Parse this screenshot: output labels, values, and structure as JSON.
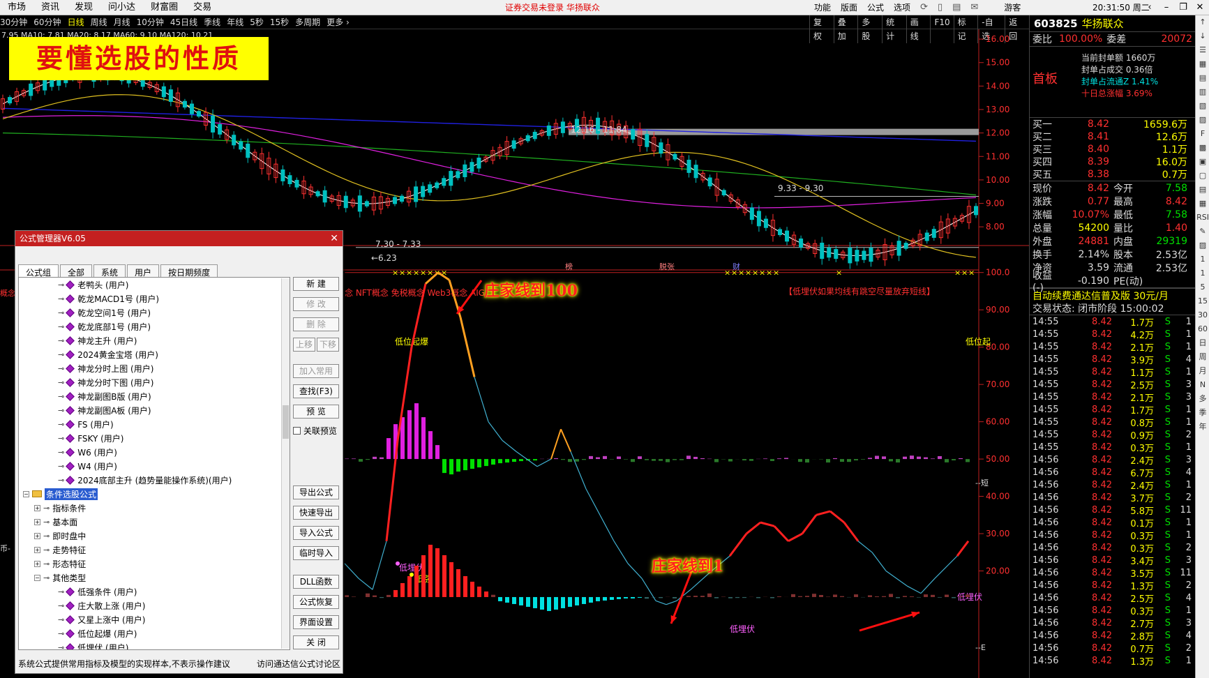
{
  "menubar": {
    "items": [
      "市场",
      "资讯",
      "发现",
      "问小达",
      "财富圈",
      "交易"
    ],
    "warning": "证券交易未登录  华扬联众",
    "right_items": [
      "功能",
      "版面",
      "公式",
      "选项"
    ],
    "user": "游客",
    "clock": "20:31:50 周二"
  },
  "periods": {
    "items": [
      "30分钟",
      "60分钟",
      "日线",
      "周线",
      "月线",
      "10分钟",
      "45日线",
      "季线",
      "年线",
      "5秒",
      "15秒",
      "多周期",
      "更多 ›"
    ],
    "active": "日线",
    "tools": [
      "复权",
      "叠加",
      "多股",
      "统计",
      "画线",
      "F10",
      "标记",
      "-自选",
      "返回"
    ]
  },
  "ma_legend": "7.95  MA10: 7.81  MA20: 8.17  MA60: 9.10  MA120: 10.21",
  "banner": "要懂选股的性质",
  "price_axis": [
    "16.00",
    "15.00",
    "14.00",
    "13.00",
    "12.00",
    "11.00",
    "10.00",
    "9.00",
    "8.00"
  ],
  "osc_axis": [
    "100.0",
    "90.00",
    "80.00",
    "70.00",
    "60.00",
    "50.00",
    "40.00",
    "30.00",
    "20.00"
  ],
  "chart_labels": {
    "range1": "12.16 - 11.84",
    "range2": "9.33 - 9.30",
    "range3": "7.30 - 7.33",
    "low": "←6.23",
    "tag_bang": "榜",
    "tag_chuzhang": "脱张",
    "tag_cai": "财",
    "concept": "念 NFT概念 免税概念 Web3概念 AIG",
    "concept_left": "概念",
    "tip": "【低埋伏如果均线有跳空尽量放弃短线】",
    "low_start_1": "低位起爆",
    "low_start_2": "低位起",
    "low_ambush_1": "低埋伏",
    "low_strong": "低强",
    "low_ambush_2": "低埋伏",
    "low_ambush_3": "低埋伏",
    "right_marker": "--短",
    "right_marker2": "--E",
    "left_coin": "币-"
  },
  "annotations": {
    "to100": "庄家线到100",
    "to1": "庄家线到1"
  },
  "stock": {
    "code": "603825",
    "name": "华扬联众",
    "webi_label": "委比",
    "webi": "100.00%",
    "weicha_label": "委差",
    "weicha": "20072",
    "first_board": "首板",
    "info": [
      "当前封单额 1660万",
      "封单占成交 0.36倍",
      "封单占流通Z 1.41%",
      "十日总涨幅 3.69%"
    ],
    "orderbook": [
      {
        "label": "买一",
        "price": "8.42",
        "vol": "1659.6万"
      },
      {
        "label": "买二",
        "price": "8.41",
        "vol": "12.6万"
      },
      {
        "label": "买三",
        "price": "8.40",
        "vol": "1.1万"
      },
      {
        "label": "买四",
        "price": "8.39",
        "vol": "16.0万"
      },
      {
        "label": "买五",
        "price": "8.38",
        "vol": "0.7万"
      }
    ],
    "quotes": [
      {
        "k1": "现价",
        "v1": "8.42",
        "c1": "red",
        "k2": "今开",
        "v2": "7.58",
        "c2": "green"
      },
      {
        "k1": "涨跌",
        "v1": "0.77",
        "c1": "red",
        "k2": "最高",
        "v2": "8.42",
        "c2": "red"
      },
      {
        "k1": "涨幅",
        "v1": "10.07%",
        "c1": "red",
        "k2": "最低",
        "v2": "7.58",
        "c2": "green"
      },
      {
        "k1": "总量",
        "v1": "54200",
        "c1": "yellow",
        "k2": "量比",
        "v2": "1.40",
        "c2": "red"
      },
      {
        "k1": "外盘",
        "v1": "24881",
        "c1": "red",
        "k2": "内盘",
        "v2": "29319",
        "c2": "green"
      },
      {
        "k1": "换手",
        "v1": "2.14%",
        "c1": "white",
        "k2": "股本",
        "v2": "2.53亿",
        "c2": "white"
      },
      {
        "k1": "净资",
        "v1": "3.59",
        "c1": "white",
        "k2": "流通",
        "v2": "2.53亿",
        "c2": "white"
      },
      {
        "k1": "收益(-)",
        "v1": "-0.190",
        "c1": "white",
        "k2": "PE(动)",
        "v2": "",
        "c2": "white"
      }
    ],
    "ad": "自动续费通达信普及版  30元/月",
    "status": "交易状态: 闭市阶段  15:00:02",
    "ticks": [
      {
        "t": "14:55",
        "p": "8.42",
        "v": "1.7万",
        "s": "S",
        "n": "1"
      },
      {
        "t": "14:55",
        "p": "8.42",
        "v": "4.2万",
        "s": "S",
        "n": "1"
      },
      {
        "t": "14:55",
        "p": "8.42",
        "v": "2.1万",
        "s": "S",
        "n": "1"
      },
      {
        "t": "14:55",
        "p": "8.42",
        "v": "3.9万",
        "s": "S",
        "n": "4"
      },
      {
        "t": "14:55",
        "p": "8.42",
        "v": "1.1万",
        "s": "S",
        "n": "1"
      },
      {
        "t": "14:55",
        "p": "8.42",
        "v": "2.5万",
        "s": "S",
        "n": "3"
      },
      {
        "t": "14:55",
        "p": "8.42",
        "v": "2.1万",
        "s": "S",
        "n": "3"
      },
      {
        "t": "14:55",
        "p": "8.42",
        "v": "1.7万",
        "s": "S",
        "n": "1"
      },
      {
        "t": "14:55",
        "p": "8.42",
        "v": "0.8万",
        "s": "S",
        "n": "1"
      },
      {
        "t": "14:55",
        "p": "8.42",
        "v": "0.9万",
        "s": "S",
        "n": "2"
      },
      {
        "t": "14:55",
        "p": "8.42",
        "v": "0.3万",
        "s": "S",
        "n": "1"
      },
      {
        "t": "14:56",
        "p": "8.42",
        "v": "2.4万",
        "s": "S",
        "n": "3"
      },
      {
        "t": "14:56",
        "p": "8.42",
        "v": "6.7万",
        "s": "S",
        "n": "4"
      },
      {
        "t": "14:56",
        "p": "8.42",
        "v": "2.4万",
        "s": "S",
        "n": "1"
      },
      {
        "t": "14:56",
        "p": "8.42",
        "v": "3.7万",
        "s": "S",
        "n": "2"
      },
      {
        "t": "14:56",
        "p": "8.42",
        "v": "5.8万",
        "s": "S",
        "n": "11"
      },
      {
        "t": "14:56",
        "p": "8.42",
        "v": "0.1万",
        "s": "S",
        "n": "1"
      },
      {
        "t": "14:56",
        "p": "8.42",
        "v": "0.3万",
        "s": "S",
        "n": "1"
      },
      {
        "t": "14:56",
        "p": "8.42",
        "v": "0.3万",
        "s": "S",
        "n": "2"
      },
      {
        "t": "14:56",
        "p": "8.42",
        "v": "3.4万",
        "s": "S",
        "n": "3"
      },
      {
        "t": "14:56",
        "p": "8.42",
        "v": "3.5万",
        "s": "S",
        "n": "11"
      },
      {
        "t": "14:56",
        "p": "8.42",
        "v": "1.3万",
        "s": "S",
        "n": "2"
      },
      {
        "t": "14:56",
        "p": "8.42",
        "v": "2.5万",
        "s": "S",
        "n": "4"
      },
      {
        "t": "14:56",
        "p": "8.42",
        "v": "0.3万",
        "s": "S",
        "n": "1"
      },
      {
        "t": "14:56",
        "p": "8.42",
        "v": "2.7万",
        "s": "S",
        "n": "3"
      },
      {
        "t": "14:56",
        "p": "8.42",
        "v": "2.8万",
        "s": "S",
        "n": "4"
      },
      {
        "t": "14:56",
        "p": "8.42",
        "v": "0.7万",
        "s": "S",
        "n": "2"
      },
      {
        "t": "14:56",
        "p": "8.42",
        "v": "1.3万",
        "s": "S",
        "n": "1"
      }
    ]
  },
  "icon_strip": [
    "↑",
    "↓",
    "☰",
    "▦",
    "▤",
    "▥",
    "▧",
    "▨",
    "F",
    "▩",
    "▣",
    "▢",
    "▤",
    "▦",
    "RSI",
    "✎",
    "▨",
    "1",
    "1",
    "5",
    "15",
    "30",
    "60",
    "日",
    "周",
    "月",
    "N",
    "多",
    "季",
    "年"
  ],
  "dialog": {
    "title": "公式管理器V6.05",
    "close": "✕",
    "tabs": [
      "公式组",
      "全部",
      "系统",
      "用户",
      "按日期频度"
    ],
    "tree": [
      {
        "type": "gem",
        "label": "老鸭头 (用户)",
        "indent": 2
      },
      {
        "type": "gem",
        "label": "乾龙MACD1号 (用户)",
        "indent": 2
      },
      {
        "type": "gem",
        "label": "乾龙空间1号 (用户)",
        "indent": 2
      },
      {
        "type": "gem",
        "label": "乾龙底部1号 (用户)",
        "indent": 2
      },
      {
        "type": "gem",
        "label": "神龙主升 (用户)",
        "indent": 2
      },
      {
        "type": "gem",
        "label": "2024黄金宝塔 (用户)",
        "indent": 2
      },
      {
        "type": "gem",
        "label": "神龙分时上图 (用户)",
        "indent": 2
      },
      {
        "type": "gem",
        "label": "神龙分时下图 (用户)",
        "indent": 2
      },
      {
        "type": "gem",
        "label": "神龙副图B版 (用户)",
        "indent": 2
      },
      {
        "type": "gem",
        "label": "神龙副图A板 (用户)",
        "indent": 2
      },
      {
        "type": "gem",
        "label": "FS (用户)",
        "indent": 2
      },
      {
        "type": "gem",
        "label": "FSKY (用户)",
        "indent": 2
      },
      {
        "type": "gem",
        "label": "W6 (用户)",
        "indent": 2
      },
      {
        "type": "gem",
        "label": "W4 (用户)",
        "indent": 2
      },
      {
        "type": "gem",
        "label": "2024底部主升 (趋势量能操作系统)(用户)",
        "indent": 2
      },
      {
        "type": "folder",
        "label": "条件选股公式",
        "indent": 0,
        "selected": true
      },
      {
        "type": "node",
        "label": "指标条件",
        "indent": 1
      },
      {
        "type": "node",
        "label": "基本面",
        "indent": 1
      },
      {
        "type": "node",
        "label": "即时盘中",
        "indent": 1
      },
      {
        "type": "node",
        "label": "走势特征",
        "indent": 1
      },
      {
        "type": "node",
        "label": "形态特征",
        "indent": 1
      },
      {
        "type": "node-open",
        "label": "其他类型",
        "indent": 1
      },
      {
        "type": "gem",
        "label": "低强条件 (用户)",
        "indent": 2
      },
      {
        "type": "gem",
        "label": "庄大散上涨 (用户)",
        "indent": 2
      },
      {
        "type": "gem",
        "label": "又星上涨中 (用户)",
        "indent": 2
      },
      {
        "type": "gem",
        "label": "低位起爆 (用户)",
        "indent": 2
      },
      {
        "type": "gem",
        "label": "低埋伏 (用户)",
        "indent": 2
      }
    ],
    "buttons_top": [
      "新 建",
      "修 改",
      "删 除"
    ],
    "move_up": "上移",
    "move_down": "下移",
    "buttons_mid": [
      "加入常用",
      "查找(F3)",
      "预 览"
    ],
    "check_label": "关联预览",
    "buttons_bottom": [
      "导出公式",
      "快速导出",
      "导入公式",
      "临时导入"
    ],
    "buttons_bottom2": [
      "DLL函数",
      "公式恢复",
      "界面设置",
      "关 闭"
    ],
    "footer_left": "系统公式提供常用指标及模型的实现样本,不表示操作建议",
    "footer_right": "访问通达信公式讨论区"
  },
  "chart_data": {
    "type": "line",
    "price_ylim": [
      7.5,
      16.3
    ],
    "osc_ylim": [
      10,
      102
    ]
  }
}
